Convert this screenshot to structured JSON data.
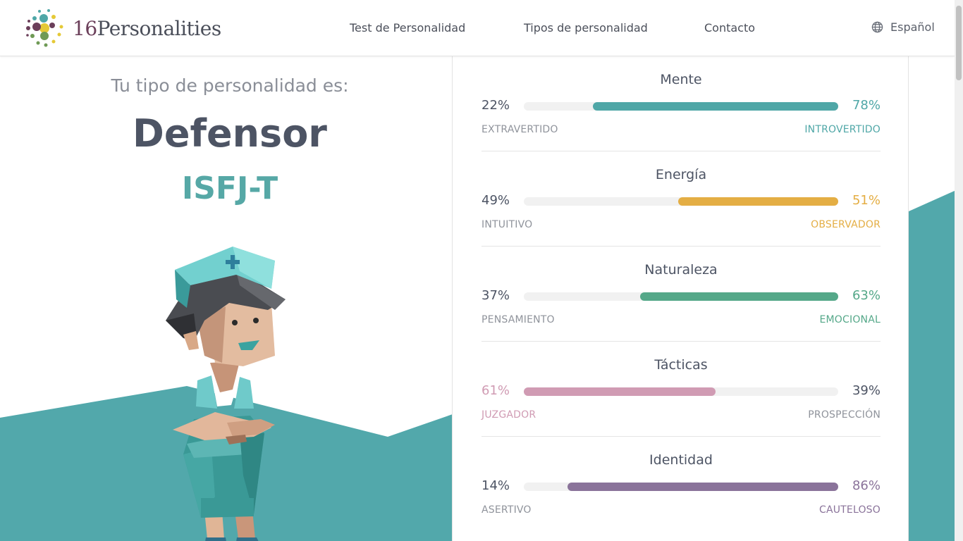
{
  "header": {
    "logo_number": "16",
    "logo_word": "Personalities",
    "nav": [
      {
        "label": "Test de Personalidad"
      },
      {
        "label": "Tipos de personalidad"
      },
      {
        "label": "Contacto"
      }
    ],
    "language": "Español"
  },
  "result": {
    "intro": "Tu tipo de personalidad es:",
    "type_name": "Defensor",
    "type_code": "ISFJ-T"
  },
  "traits": [
    {
      "title": "Mente",
      "left_pct": "22%",
      "right_pct": "78%",
      "left_label": "EXTRAVERTIDO",
      "right_label": "INTROVERTIDO",
      "dominant": "right",
      "value": 78,
      "color": "#4fa7a7"
    },
    {
      "title": "Energía",
      "left_pct": "49%",
      "right_pct": "51%",
      "left_label": "INTUITIVO",
      "right_label": "OBSERVADOR",
      "dominant": "right",
      "value": 51,
      "color": "#e4ae44"
    },
    {
      "title": "Naturaleza",
      "left_pct": "37%",
      "right_pct": "63%",
      "left_label": "PENSAMIENTO",
      "right_label": "EMOCIONAL",
      "dominant": "right",
      "value": 63,
      "color": "#55a889"
    },
    {
      "title": "Tácticas",
      "left_pct": "61%",
      "right_pct": "39%",
      "left_label": "JUZGADOR",
      "right_label": "PROSPECCIÓN",
      "dominant": "left",
      "value": 61,
      "color": "#d09bb3"
    },
    {
      "title": "Identidad",
      "left_pct": "14%",
      "right_pct": "86%",
      "left_label": "ASERTIVO",
      "right_label": "CAUTELOSO",
      "dominant": "right",
      "value": 86,
      "color": "#8a739a"
    }
  ],
  "colors": {
    "teal_bg": "#52a8ab",
    "heading": "#4d5464",
    "accent_code": "#56a8a6",
    "muted": "#8f939b"
  },
  "icons": {
    "language": "globe-icon",
    "logo": "dots-logo-icon"
  }
}
